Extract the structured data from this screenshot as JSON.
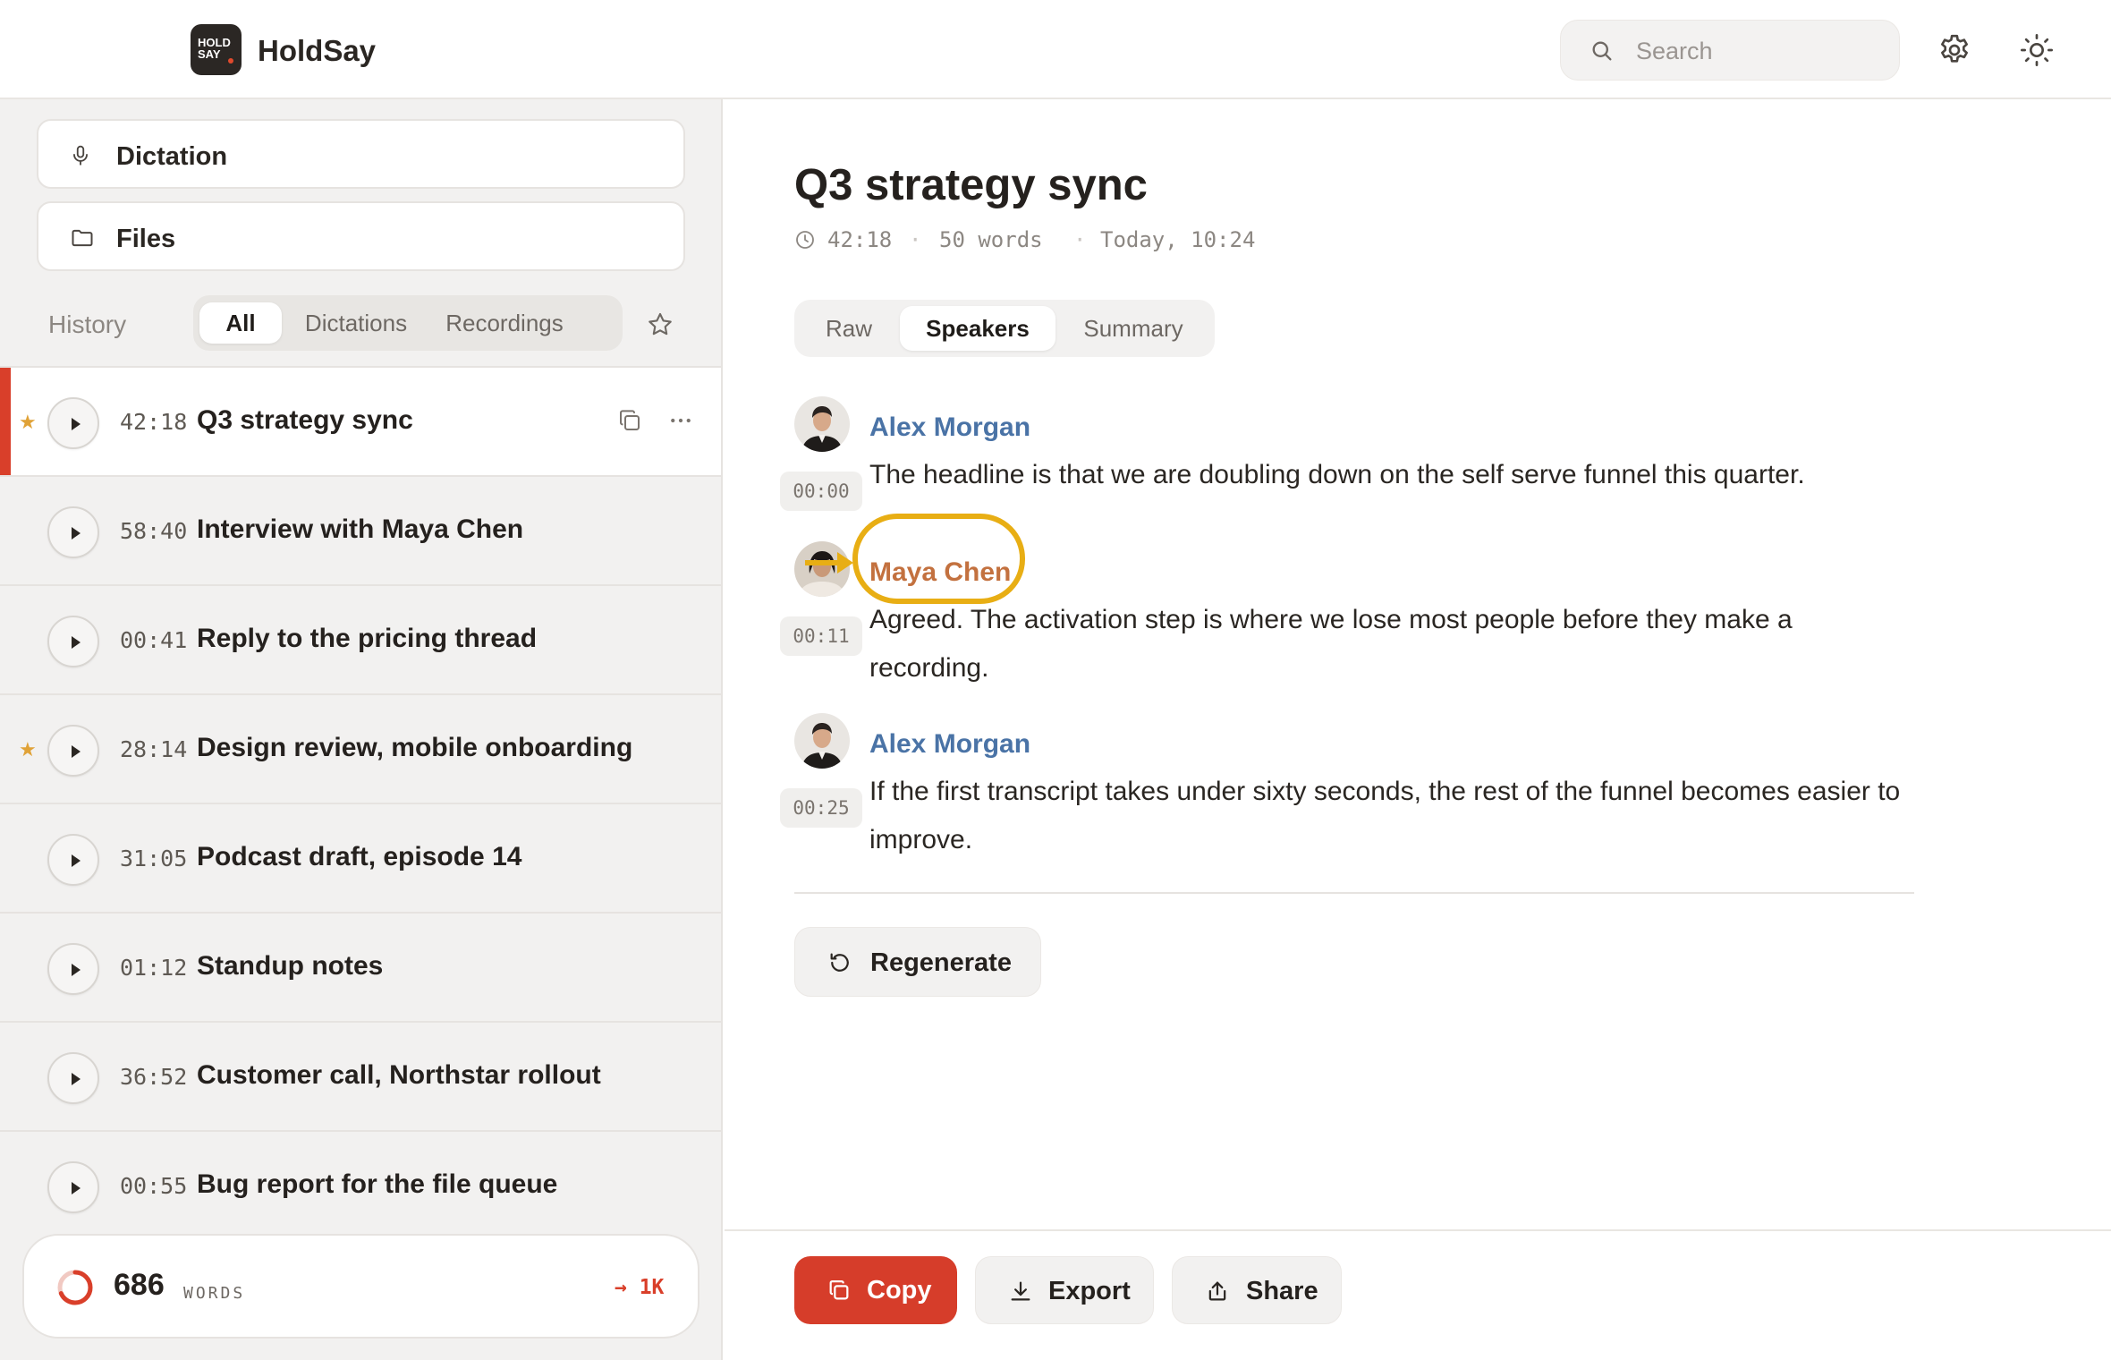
{
  "app": {
    "logo_text_1": "HOLD",
    "logo_text_2": "SAY",
    "name": "HoldSay"
  },
  "header": {
    "search_placeholder": "Search",
    "icons": [
      "search-icon",
      "gear-icon",
      "sun-icon"
    ]
  },
  "sidebar": {
    "nav": [
      {
        "label": "Dictation",
        "icon": "microphone-icon"
      },
      {
        "label": "Files",
        "icon": "folder-icon"
      }
    ],
    "history_label": "History",
    "filters": [
      {
        "label": "All",
        "active": true
      },
      {
        "label": "Dictations",
        "active": false
      },
      {
        "label": "Recordings",
        "active": false
      }
    ],
    "items": [
      {
        "duration": "42:18",
        "title": "Q3 strategy sync",
        "starred": true,
        "active": true
      },
      {
        "duration": "58:40",
        "title": "Interview with Maya Chen",
        "starred": false
      },
      {
        "duration": "00:41",
        "title": "Reply to the pricing thread",
        "starred": false
      },
      {
        "duration": "28:14",
        "title": "Design review, mobile onboarding",
        "starred": true
      },
      {
        "duration": "31:05",
        "title": "Podcast draft, episode 14",
        "starred": false
      },
      {
        "duration": "01:12",
        "title": "Standup notes",
        "starred": false
      },
      {
        "duration": "36:52",
        "title": "Customer call, Northstar rollout",
        "starred": false
      },
      {
        "duration": "00:55",
        "title": "Bug report for the file queue",
        "starred": false
      }
    ],
    "words": {
      "count": "686",
      "unit": "WORDS",
      "goal": "→ 1K",
      "progress": 0.686
    }
  },
  "main": {
    "title": "Q3 strategy sync",
    "meta": {
      "duration": "42:18",
      "words": "50 words",
      "date": "Today, 10:24",
      "separator": "·"
    },
    "views": [
      {
        "label": "Raw",
        "active": false
      },
      {
        "label": "Speakers",
        "active": true
      },
      {
        "label": "Summary",
        "active": false
      }
    ],
    "transcript": [
      {
        "speaker": "Alex Morgan",
        "time": "00:00",
        "text": "The headline is that we are doubling down on the self serve funnel this quarter."
      },
      {
        "speaker": "Maya Chen",
        "time": "00:11",
        "text": "Agreed. The activation step is where we lose most people before they make a recording."
      },
      {
        "speaker": "Alex Morgan",
        "time": "00:25",
        "text": "If the first transcript takes under sixty seconds, the rest of the funnel becomes easier to improve."
      }
    ],
    "regenerate_label": "Regenerate",
    "actions": {
      "copy": "Copy",
      "export": "Export",
      "share": "Share"
    }
  },
  "colors": {
    "accent": "#d63d2a",
    "speaker_a": "#4a73a6",
    "speaker_b": "#c3713f",
    "highlight": "#e8ae14",
    "star": "#e0a237"
  }
}
